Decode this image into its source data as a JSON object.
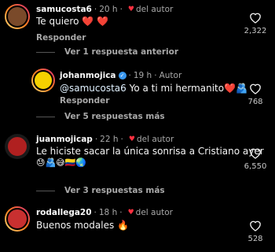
{
  "comments": [
    {
      "username": "samucosta6",
      "time": "20 h",
      "liked_by_author": "del autor",
      "text": "Te quiero ❤️ ❤️",
      "reply_label": "Responder",
      "likes": "2,322",
      "avatar_color": "#7a4a2a"
    },
    {
      "username": "johanmojica",
      "time": "19 h",
      "author_tag": "Autor",
      "mention": "@samucosta6",
      "text": " Yo a ti mi hermanito❤️🫂",
      "reply_label": "Responder",
      "likes": "768",
      "avatar_color": "#f5d000"
    },
    {
      "username": "juanmojicap",
      "time": "22 h",
      "liked_by_author": "del autor",
      "text_line1": "Le hiciste sacar la única sonrisa a Cristiano ayer",
      "text_line2": "😓🫂😅🇨🇴🌏",
      "reply_label": "",
      "likes": "6,550",
      "avatar_color": "#b02020"
    },
    {
      "username": "rodallega20",
      "time": "18 h",
      "liked_by_author": "del autor",
      "text": "Buenos modales 🔥",
      "reply_label": "",
      "likes": "528",
      "avatar_color": "#c83030"
    }
  ],
  "replies_toggle": [
    {
      "label": "Ver 1 respuesta anterior"
    },
    {
      "label": "Ver 5 respuestas más"
    },
    {
      "label": "Ver 3 respuestas más"
    }
  ],
  "colors": {
    "background": "#000000",
    "story_ring_start": "#feda75",
    "story_ring_end": "#d62976",
    "verified": "#3897f0",
    "liked_heart": "#ff3040"
  }
}
